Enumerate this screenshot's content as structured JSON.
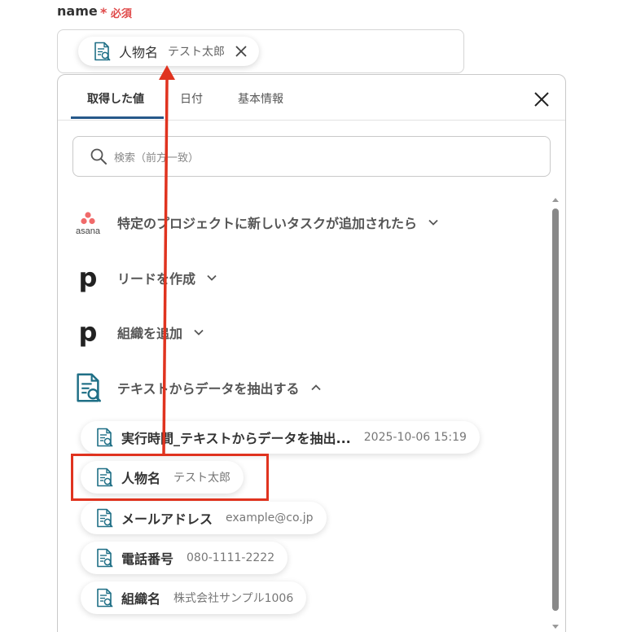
{
  "field": {
    "label": "name",
    "required_star": "*",
    "required_text": "必須"
  },
  "token": {
    "name": "人物名",
    "value": "テスト太郎",
    "icon": "document-search-icon",
    "remove_icon": "close-icon"
  },
  "tabs": [
    {
      "label": "取得した値",
      "active": true
    },
    {
      "label": "日付",
      "active": false
    },
    {
      "label": "基本情報",
      "active": false
    }
  ],
  "search": {
    "placeholder": "検索（前方一致）",
    "icon": "search-icon"
  },
  "sections": [
    {
      "title": "特定のプロジェクトに新しいタスクが追加されたら",
      "icon": "asana-logo",
      "icon_text": "asana",
      "expanded": false
    },
    {
      "title": "リードを作成",
      "icon": "pipedrive-logo",
      "icon_text": "p",
      "expanded": false
    },
    {
      "title": "組織を追加",
      "icon": "pipedrive-logo",
      "icon_text": "p",
      "expanded": false
    },
    {
      "title": "テキストからデータを抽出する",
      "icon": "document-search-icon",
      "expanded": true
    }
  ],
  "items": [
    {
      "name": "実行時間_テキストからデータを抽出...",
      "value": "2025-10-06 15:19"
    },
    {
      "name": "人物名",
      "value": "テスト太郎",
      "highlighted": true
    },
    {
      "name": "メールアドレス",
      "value": "example@co.jp"
    },
    {
      "name": "電話番号",
      "value": "080-1111-2222"
    },
    {
      "name": "組織名",
      "value": "株式会社サンプル1006"
    }
  ],
  "colors": {
    "accent": "#26588a",
    "required": "#e04a4a",
    "highlight": "#e0331f",
    "icon_teal": "#1f6f86"
  }
}
